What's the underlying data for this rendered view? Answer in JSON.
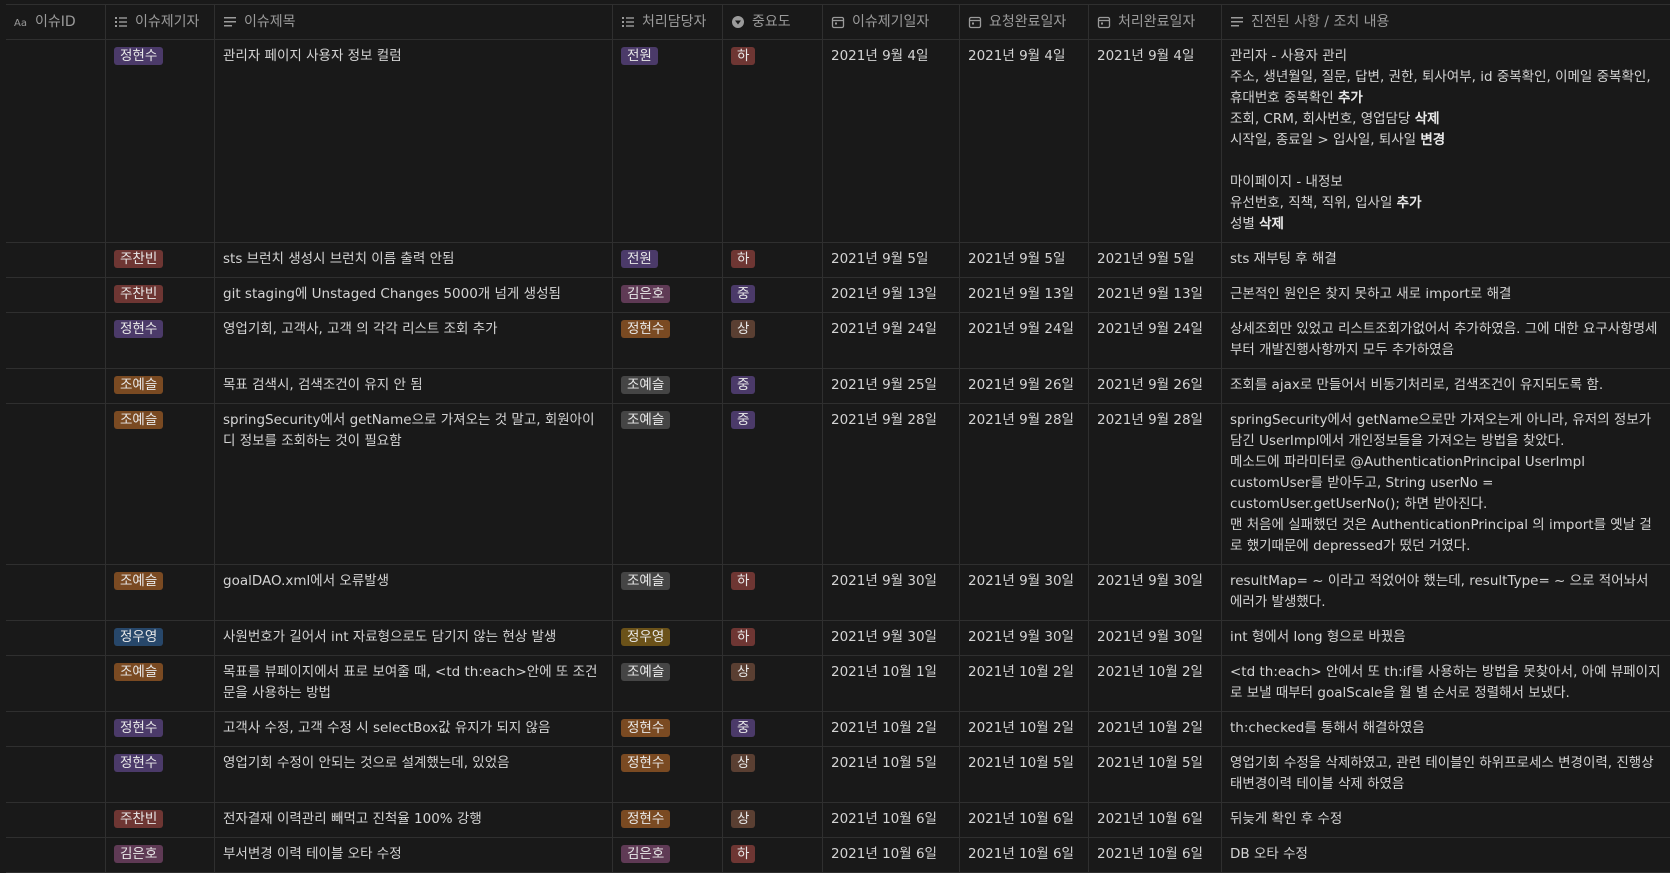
{
  "colors": {
    "background": "#191919",
    "grid": "#2f2f2f",
    "header_text": "#9b9b9b",
    "tag_purple": "#4b3a69",
    "tag_red": "#6e3633",
    "tag_brown": "#6a4a2d",
    "tag_blue": "#27476a",
    "tag_gold": "#6b5219",
    "tag_gray": "#454545"
  },
  "columns": [
    {
      "label": "이슈ID",
      "icon": "text-aa-icon"
    },
    {
      "label": "이슈제기자",
      "icon": "list-icon"
    },
    {
      "label": "이슈제목",
      "icon": "text-lines-icon"
    },
    {
      "label": "처리담당자",
      "icon": "list-icon"
    },
    {
      "label": "중요도",
      "icon": "select-icon"
    },
    {
      "label": "이슈제기일자",
      "icon": "calendar-icon"
    },
    {
      "label": "요청완료일자",
      "icon": "calendar-icon"
    },
    {
      "label": "처리완료일자",
      "icon": "calendar-icon"
    },
    {
      "label": "진전된 사항 / 조치 내용",
      "icon": "text-lines-icon"
    }
  ],
  "rows": [
    {
      "id": "",
      "raiser": {
        "text": "정현수",
        "color": "purple"
      },
      "title": "관리자 페이지 사용자 정보 컬럼",
      "handler": {
        "text": "전원",
        "color": "purple"
      },
      "priority": {
        "text": "하",
        "color": "red"
      },
      "raised": "2021년 9월 4일",
      "requested": "2021년 9월 4일",
      "done": "2021년 9월 4일",
      "detail": [
        {
          "text": "관리자 - 사용자 관리"
        },
        {
          "text": "주소, 생년월일, 질문, 답변, 권한, 퇴사여부, id 중복확인, 이메일 중복확인, 휴대번호 중복확인 ",
          "bold": "추가"
        },
        {
          "text": "조회, CRM, 회사번호, 영업담당 ",
          "bold": "삭제"
        },
        {
          "text": "시작일, 종료일 > 입사일, 퇴사일 ",
          "bold": "변경"
        },
        {
          "text": ""
        },
        {
          "text": "마이페이지 - 내정보"
        },
        {
          "text": "유선번호, 직책, 직위, 입사일 ",
          "bold": "추가"
        },
        {
          "text": "성별 ",
          "bold": "삭제"
        }
      ]
    },
    {
      "id": "",
      "raiser": {
        "text": "주찬빈",
        "color": "red"
      },
      "title": "sts 브런치 생성시 브런치 이름 출력 안됨",
      "handler": {
        "text": "전원",
        "color": "purple"
      },
      "priority": {
        "text": "하",
        "color": "red"
      },
      "raised": "2021년 9월 5일",
      "requested": "2021년 9월 5일",
      "done": "2021년 9월 5일",
      "detail": [
        {
          "text": "sts 재부팅 후 해결"
        }
      ]
    },
    {
      "id": "",
      "raiser": {
        "text": "주찬빈",
        "color": "red"
      },
      "title": "git staging에 Unstaged Changes 5000개 넘게 생성됨",
      "handler": {
        "text": "김은호",
        "color": "pink"
      },
      "priority": {
        "text": "중",
        "color": "purple"
      },
      "raised": "2021년 9월 13일",
      "requested": "2021년 9월 13일",
      "done": "2021년 9월 13일",
      "detail": [
        {
          "text": "근본적인 원인은 찾지 못하고 새로 import로 해결"
        }
      ]
    },
    {
      "id": "",
      "raiser": {
        "text": "정현수",
        "color": "purple"
      },
      "title": "영업기회, 고객사, 고객 의 각각 리스트 조회 추가",
      "handler": {
        "text": "정현수",
        "color": "orange"
      },
      "priority": {
        "text": "상",
        "color": "cocoa"
      },
      "raised": "2021년 9월 24일",
      "requested": "2021년 9월 24일",
      "done": "2021년 9월 24일",
      "detail": [
        {
          "text": "상세조회만 있었고 리스트조회가없어서 추가하였음. 그에 대한 요구사항명세부터 개발진행사항까지 모두 추가하였음"
        }
      ]
    },
    {
      "id": "",
      "raiser": {
        "text": "조예슬",
        "color": "orange"
      },
      "title": "목표 검색시, 검색조건이 유지 안 됨",
      "handler": {
        "text": "조예슬",
        "color": "gray"
      },
      "priority": {
        "text": "중",
        "color": "purple"
      },
      "raised": "2021년 9월 25일",
      "requested": "2021년 9월 26일",
      "done": "2021년 9월 26일",
      "detail": [
        {
          "text": "조회를 ajax로 만들어서 비동기처리로, 검색조건이 유지되도록 함."
        }
      ]
    },
    {
      "id": "",
      "raiser": {
        "text": "조예슬",
        "color": "orange"
      },
      "title": "springSecurity에서 getName으로 가져오는 것 말고, 회원아이디 정보를 조회하는 것이 필요함",
      "handler": {
        "text": "조예슬",
        "color": "gray"
      },
      "priority": {
        "text": "중",
        "color": "purple"
      },
      "raised": "2021년 9월 28일",
      "requested": "2021년 9월 28일",
      "done": "2021년 9월 28일",
      "detail": [
        {
          "text": "springSecurity에서 getName으로만 가져오는게 아니라, 유저의 정보가 담긴 UserImpl에서 개인정보들을 가져오는 방법을 찾았다."
        },
        {
          "text": "메소드에 파라미터로 @AuthenticationPrincipal UserImpl customUser를 받아두고, String userNo = customUser.getUserNo(); 하면 받아진다."
        },
        {
          "text": "맨 처음에 실패했던 것은 AuthenticationPrincipal 의 import를 옛날 걸로 했기때문에 depressed가 떴던 거였다."
        }
      ]
    },
    {
      "id": "",
      "raiser": {
        "text": "조예슬",
        "color": "orange"
      },
      "title": "goalDAO.xml에서 오류발생",
      "handler": {
        "text": "조예슬",
        "color": "gray"
      },
      "priority": {
        "text": "하",
        "color": "red"
      },
      "raised": "2021년 9월 30일",
      "requested": "2021년 9월 30일",
      "done": "2021년 9월 30일",
      "detail": [
        {
          "text": "resultMap= ~ 이라고 적었어야 했는데, resultType= ~ 으로 적어놔서 에러가 발생했다."
        }
      ]
    },
    {
      "id": "",
      "raiser": {
        "text": "정우영",
        "color": "blue"
      },
      "title": "사원번호가 길어서 int 자료형으로도 담기지 않는 현상 발생",
      "handler": {
        "text": "정우영",
        "color": "gold"
      },
      "priority": {
        "text": "하",
        "color": "red"
      },
      "raised": "2021년 9월 30일",
      "requested": "2021년 9월 30일",
      "done": "2021년 9월 30일",
      "detail": [
        {
          "text": "int 형에서 long 형으로 바꿨음"
        }
      ]
    },
    {
      "id": "",
      "raiser": {
        "text": "조예슬",
        "color": "orange"
      },
      "title": "목표를 뷰페이지에서 표로 보여줄 때, <td th:each>안에 또 조건문을 사용하는 방법",
      "handler": {
        "text": "조예슬",
        "color": "gray"
      },
      "priority": {
        "text": "상",
        "color": "cocoa"
      },
      "raised": "2021년 10월 1일",
      "requested": "2021년 10월 2일",
      "done": "2021년 10월 2일",
      "detail": [
        {
          "text": "<td th:each> 안에서 또 th:if를 사용하는 방법을 못찾아서, 아예 뷰페이지로 보낼 때부터 goalScale을 월 별 순서로 정렬해서 보냈다."
        }
      ]
    },
    {
      "id": "",
      "raiser": {
        "text": "정현수",
        "color": "purple"
      },
      "title": "고객사 수정, 고객 수정 시 selectBox값 유지가 되지 않음",
      "handler": {
        "text": "정현수",
        "color": "orange"
      },
      "priority": {
        "text": "중",
        "color": "purple"
      },
      "raised": "2021년 10월 2일",
      "requested": "2021년 10월 2일",
      "done": "2021년 10월 2일",
      "detail": [
        {
          "text": "th:checked를 통해서 해결하였음"
        }
      ]
    },
    {
      "id": "",
      "raiser": {
        "text": "정현수",
        "color": "purple"
      },
      "title": "영업기회 수정이 안되는 것으로 설계했는데, 있었음",
      "handler": {
        "text": "정현수",
        "color": "orange"
      },
      "priority": {
        "text": "상",
        "color": "cocoa"
      },
      "raised": "2021년 10월 5일",
      "requested": "2021년 10월 5일",
      "done": "2021년 10월 5일",
      "detail": [
        {
          "text": "영업기회 수정을 삭제하였고, 관련 테이블인 하위프로세스 변경이력, 진행상태변경이력 테이블 삭제 하였음"
        }
      ]
    },
    {
      "id": "",
      "raiser": {
        "text": "주찬빈",
        "color": "red"
      },
      "title": "전자결재 이력관리 빼먹고 진척율 100% 강행",
      "handler": {
        "text": "정현수",
        "color": "orange"
      },
      "priority": {
        "text": "상",
        "color": "cocoa"
      },
      "raised": "2021년 10월 6일",
      "requested": "2021년 10월 6일",
      "done": "2021년 10월 6일",
      "detail": [
        {
          "text": "뒤늦게 확인 후 수정"
        }
      ]
    },
    {
      "id": "",
      "raiser": {
        "text": "김은호",
        "color": "pink"
      },
      "title": "부서변경 이력 테이블 오타 수정",
      "handler": {
        "text": "김은호",
        "color": "pink"
      },
      "priority": {
        "text": "하",
        "color": "red"
      },
      "raised": "2021년 10월 6일",
      "requested": "2021년 10월 6일",
      "done": "2021년 10월 6일",
      "detail": [
        {
          "text": "DB 오타 수정"
        }
      ]
    }
  ]
}
